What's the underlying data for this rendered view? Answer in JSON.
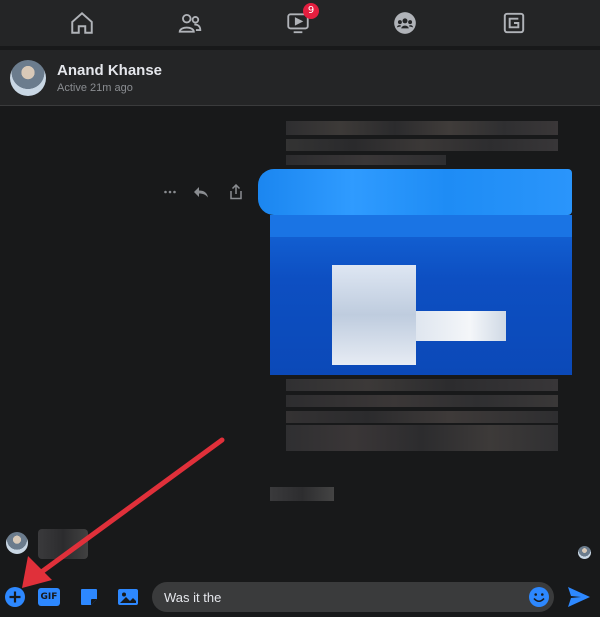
{
  "nav": {
    "items": [
      {
        "icon": "home-icon"
      },
      {
        "icon": "friends-icon"
      },
      {
        "icon": "watch-icon",
        "badge": "9"
      },
      {
        "icon": "groups-icon"
      },
      {
        "icon": "gaming-icon"
      }
    ]
  },
  "header": {
    "name": "Anand Khanse",
    "status": "Active 21m ago"
  },
  "composer": {
    "input_value": "Was it the",
    "icons": [
      "add-icon",
      "gif-icon",
      "sticker-icon",
      "photo-icon",
      "emoji-icon",
      "send-icon"
    ],
    "gif_label": "GIF"
  },
  "colors": {
    "accent": "#2d88ff",
    "badge": "#e41e3f",
    "annotation_arrow": "#e0303a",
    "background": "#18191a",
    "surface": "#242526"
  }
}
